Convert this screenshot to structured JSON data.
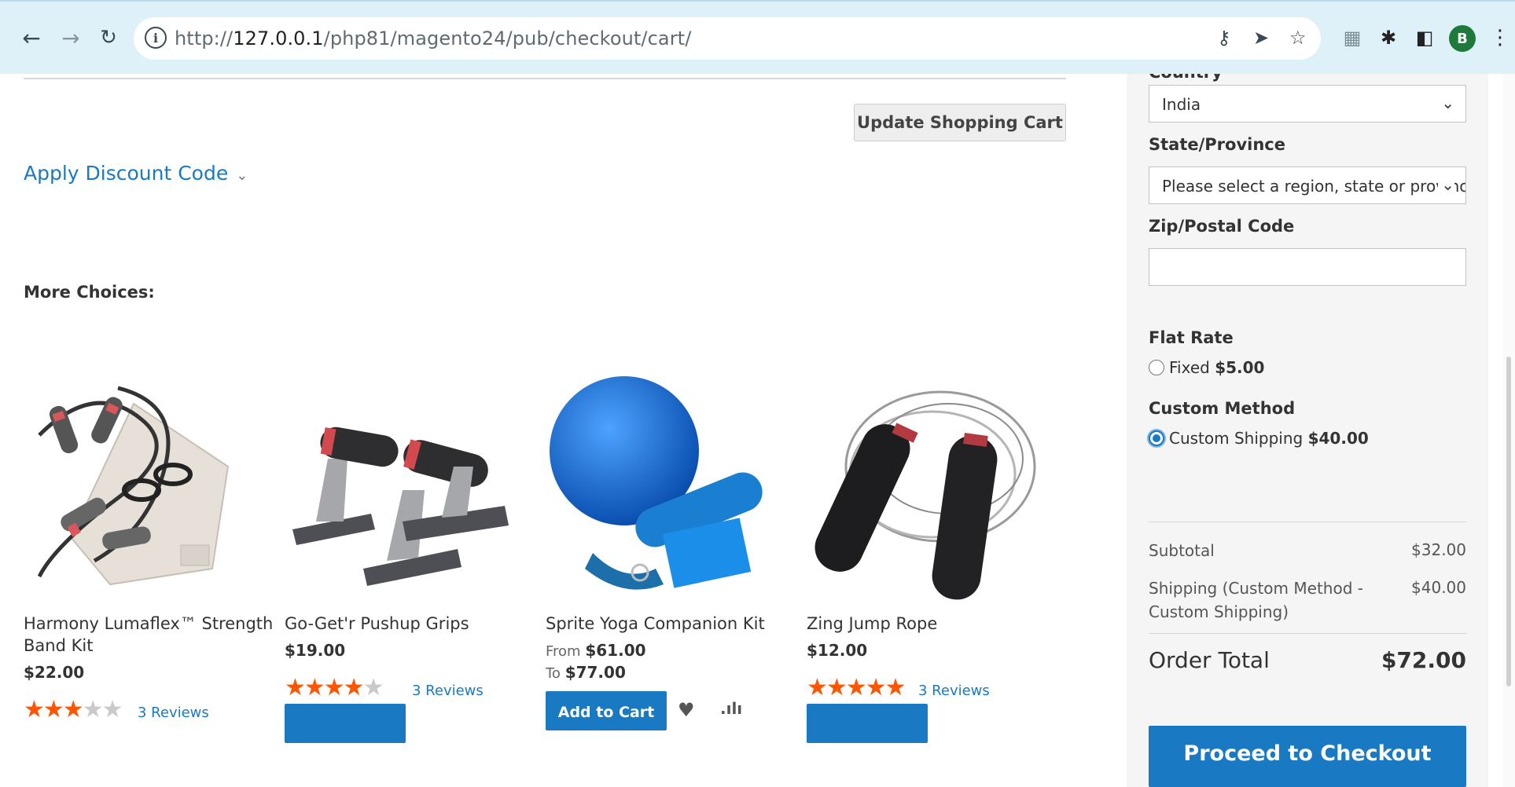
{
  "browser": {
    "url_prefix": "http://",
    "url_host": "127.0.0.1",
    "url_path": "/php81/magento24/pub/checkout/cart/",
    "profile_initial": "B"
  },
  "cart": {
    "update_label": "Update Shopping Cart",
    "discount_label": "Apply Discount Code"
  },
  "more_choices": {
    "heading": "More Choices:",
    "products": [
      {
        "name": "Harmony Lumaflex™ Strength Band Kit",
        "price": "$22.00",
        "rating": 3,
        "reviews": "3 Reviews"
      },
      {
        "name": "Go-Get'r Pushup Grips",
        "price": "$19.00",
        "rating": 4,
        "reviews": "3 Reviews"
      },
      {
        "name": "Sprite Yoga Companion Kit",
        "from_label": "From",
        "from_price": "$61.00",
        "to_label": "To",
        "to_price": "$77.00",
        "add_to_cart": "Add to Cart"
      },
      {
        "name": "Zing Jump Rope",
        "price": "$12.00",
        "rating": 5,
        "reviews": "3 Reviews"
      }
    ]
  },
  "summary": {
    "country_label": "Country",
    "country_value": "India",
    "state_label": "State/Province",
    "state_placeholder": "Please select a region, state or province.",
    "zip_label": "Zip/Postal Code",
    "flat_rate": {
      "title": "Flat Rate",
      "option": "Fixed",
      "price": "$5.00"
    },
    "custom_method": {
      "title": "Custom Method",
      "option": "Custom Shipping",
      "price": "$40.00"
    },
    "subtotal_label": "Subtotal",
    "subtotal_value": "$32.00",
    "shipping_label": "Shipping (Custom Method - Custom Shipping)",
    "shipping_value": "$40.00",
    "order_total_label": "Order Total",
    "order_total_value": "$72.00",
    "checkout_label": "Proceed to Checkout"
  },
  "colors": {
    "accent": "#1979c3",
    "star": "#ff5501",
    "chrome": "#dff1f8"
  }
}
